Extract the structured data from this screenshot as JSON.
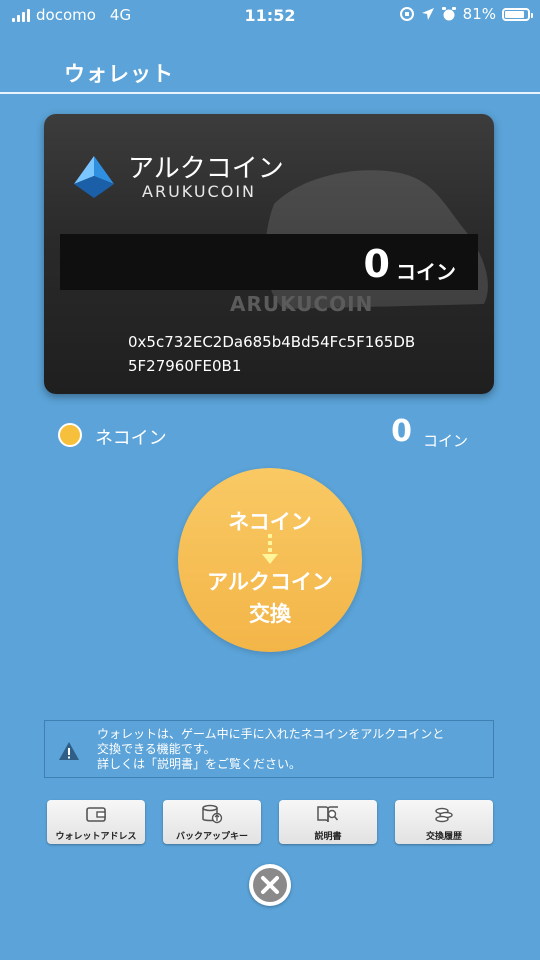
{
  "status_bar": {
    "carrier": "docomo",
    "network": "4G",
    "time": "11:52",
    "battery": "81%"
  },
  "header": {
    "title": "ウォレット"
  },
  "card": {
    "name": "アルクコイン",
    "subtitle": "ARUKUCOIN",
    "watermark": "ARUKUCOIN",
    "balance": "0",
    "unit": "コイン",
    "address_line1": "0x5c732EC2Da685b4Bd54Fc5F165DB",
    "address_line2": "5F27960FE0B1"
  },
  "neko": {
    "label": "ネコイン",
    "amount": "0",
    "unit": "コイン"
  },
  "exchange": {
    "line1": "ネコイン",
    "line2": "アルクコイン",
    "line3": "交換"
  },
  "notice": {
    "text1": "ウォレットは、ゲーム中に手に入れたネコインをアルクコインと",
    "text2": "交換できる機能です。",
    "text3": "詳しくは「説明書」をご覧ください。"
  },
  "buttons": {
    "wallet_address": "ウォレットアドレス",
    "backup_key": "バックアップキー",
    "manual": "説明書",
    "history": "交換履歴"
  },
  "colors": {
    "background": "#5ba3d8",
    "accent": "#f3b548"
  }
}
